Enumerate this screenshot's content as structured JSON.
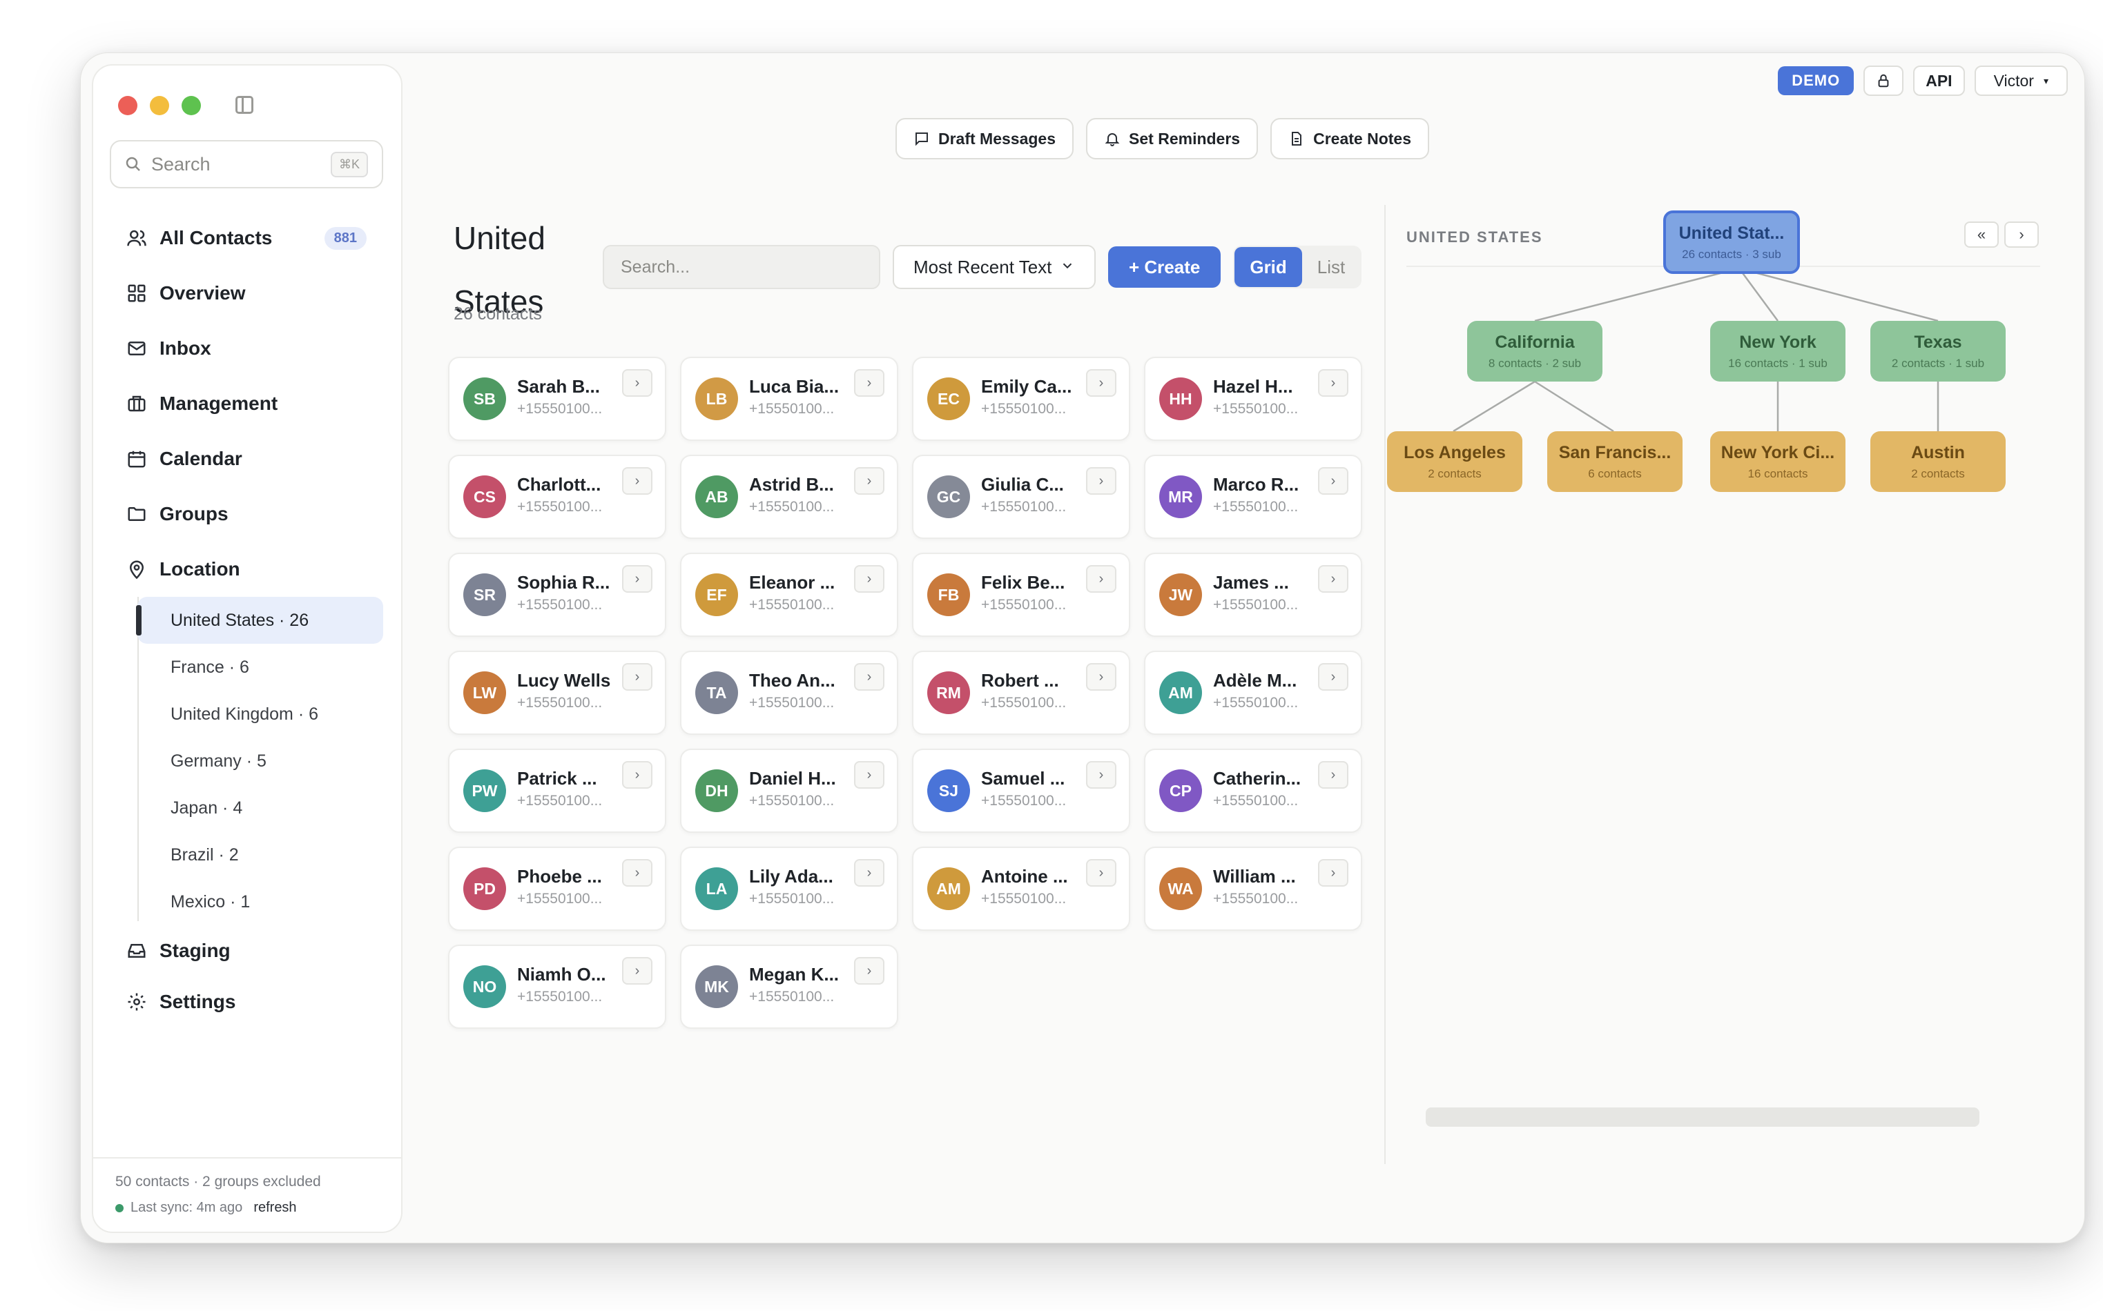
{
  "sidebar": {
    "search_placeholder": "Search",
    "search_shortcut": "⌘K",
    "nav": [
      {
        "label": "All Contacts",
        "count": "881"
      },
      {
        "label": "Overview"
      },
      {
        "label": "Inbox"
      },
      {
        "label": "Management"
      },
      {
        "label": "Calendar"
      },
      {
        "label": "Groups"
      },
      {
        "label": "Location"
      }
    ],
    "locations": [
      {
        "label": "United States · 26"
      },
      {
        "label": "France · 6"
      },
      {
        "label": "United Kingdom · 6"
      },
      {
        "label": "Germany · 5"
      },
      {
        "label": "Japan · 4"
      },
      {
        "label": "Brazil · 2"
      },
      {
        "label": "Mexico · 1"
      }
    ],
    "nav_bottom": [
      {
        "label": "Staging"
      },
      {
        "label": "Settings"
      }
    ],
    "footer": {
      "summary": "50 contacts · 2 groups excluded",
      "sync": "Last sync: 4m ago",
      "refresh": "refresh"
    }
  },
  "topbar": {
    "demo": "DEMO",
    "api": "API",
    "user": "Victor"
  },
  "actions": {
    "draft": "Draft Messages",
    "reminders": "Set Reminders",
    "notes": "Create Notes"
  },
  "main": {
    "title": "United States",
    "subtitle": "26 contacts",
    "search_placeholder": "Search...",
    "sort": "Most Recent Text",
    "create": "+ Create",
    "view_grid": "Grid",
    "view_list": "List"
  },
  "contacts": [
    {
      "initials": "SB",
      "name": "Sarah B...",
      "phone": "+15550100...",
      "color": "#4f9a63"
    },
    {
      "initials": "LB",
      "name": "Luca Bia...",
      "phone": "+15550100...",
      "color": "#d19a45"
    },
    {
      "initials": "EC",
      "name": "Emily Ca...",
      "phone": "+15550100...",
      "color": "#cf9a3c"
    },
    {
      "initials": "HH",
      "name": "Hazel H...",
      "phone": "+15550100...",
      "color": "#c4506a"
    },
    {
      "initials": "CS",
      "name": "Charlott...",
      "phone": "+15550100...",
      "color": "#c4506a"
    },
    {
      "initials": "AB",
      "name": "Astrid B...",
      "phone": "+15550100...",
      "color": "#4f9a63"
    },
    {
      "initials": "GC",
      "name": "Giulia C...",
      "phone": "+15550100...",
      "color": "#858a97"
    },
    {
      "initials": "MR",
      "name": "Marco R...",
      "phone": "+15550100...",
      "color": "#8058c4"
    },
    {
      "initials": "SR",
      "name": "Sophia R...",
      "phone": "+15550100...",
      "color": "#7d8394"
    },
    {
      "initials": "EF",
      "name": "Eleanor ...",
      "phone": "+15550100...",
      "color": "#cf9a3c"
    },
    {
      "initials": "FB",
      "name": "Felix Be...",
      "phone": "+15550100...",
      "color": "#c97a3c"
    },
    {
      "initials": "JW",
      "name": "James ...",
      "phone": "+15550100...",
      "color": "#c97a3c"
    },
    {
      "initials": "LW",
      "name": "Lucy Wells",
      "phone": "+15550100...",
      "color": "#c97a3c"
    },
    {
      "initials": "TA",
      "name": "Theo An...",
      "phone": "+15550100...",
      "color": "#7d8394"
    },
    {
      "initials": "RM",
      "name": "Robert ...",
      "phone": "+15550100...",
      "color": "#c4506a"
    },
    {
      "initials": "AM",
      "name": "Adèle M...",
      "phone": "+15550100...",
      "color": "#3ea095"
    },
    {
      "initials": "PW",
      "name": "Patrick ...",
      "phone": "+15550100...",
      "color": "#3ea095"
    },
    {
      "initials": "DH",
      "name": "Daniel H...",
      "phone": "+15550100...",
      "color": "#4f9a63"
    },
    {
      "initials": "SJ",
      "name": "Samuel ...",
      "phone": "+15550100...",
      "color": "#4a74d8"
    },
    {
      "initials": "CP",
      "name": "Catherin...",
      "phone": "+15550100...",
      "color": "#8058c4"
    },
    {
      "initials": "PD",
      "name": "Phoebe ...",
      "phone": "+15550100...",
      "color": "#c4506a"
    },
    {
      "initials": "LA",
      "name": "Lily Ada...",
      "phone": "+15550100...",
      "color": "#3ea095"
    },
    {
      "initials": "AM",
      "name": "Antoine ...",
      "phone": "+15550100...",
      "color": "#cf9a3c"
    },
    {
      "initials": "WA",
      "name": "William ...",
      "phone": "+15550100...",
      "color": "#c97a3c"
    },
    {
      "initials": "NO",
      "name": "Niamh O...",
      "phone": "+15550100...",
      "color": "#3ea095"
    },
    {
      "initials": "MK",
      "name": "Megan K...",
      "phone": "+15550100...",
      "color": "#7d8394"
    }
  ],
  "tree": {
    "title": "UNITED STATES",
    "root": {
      "name": "United Stat...",
      "meta": "26 contacts · 3 sub"
    },
    "children": [
      {
        "name": "California",
        "meta": "8 contacts · 2 sub"
      },
      {
        "name": "New York",
        "meta": "16 contacts · 1 sub"
      },
      {
        "name": "Texas",
        "meta": "2 contacts · 1 sub"
      }
    ],
    "grandchildren": [
      {
        "name": "Los Angeles",
        "meta": "2 contacts"
      },
      {
        "name": "San Francis...",
        "meta": "6 contacts"
      },
      {
        "name": "New York Ci...",
        "meta": "16 contacts"
      },
      {
        "name": "Austin",
        "meta": "2 contacts"
      }
    ]
  }
}
